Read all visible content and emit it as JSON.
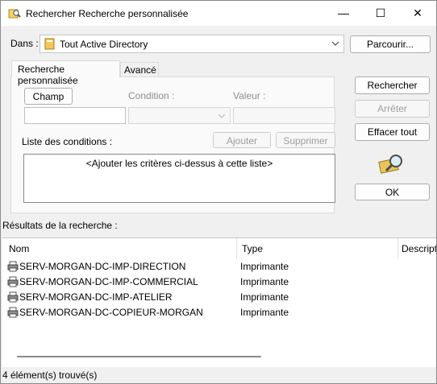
{
  "window": {
    "title": "Rechercher Recherche personnalisée",
    "minimize_glyph": "—",
    "maximize_glyph": "☐",
    "close_glyph": "✕"
  },
  "dans": {
    "label": "Dans :",
    "value": "Tout Active Directory",
    "browse_label": "Parcourir..."
  },
  "tabs": [
    {
      "label": "Recherche personnalisée",
      "active": true
    },
    {
      "label": "Avancé",
      "active": false
    }
  ],
  "criteria": {
    "field_button": "Champ",
    "condition_label": "Condition :",
    "value_label": "Valeur :",
    "add_button": "Ajouter",
    "remove_button": "Supprimer",
    "conditions_label": "Liste des conditions :",
    "conditions_placeholder": "<Ajouter les critères ci-dessus à cette liste>"
  },
  "actions": {
    "search": "Rechercher",
    "stop": "Arrêter",
    "clear_all": "Effacer tout",
    "ok": "OK"
  },
  "results": {
    "label": "Résultats de la recherche :",
    "columns": [
      "Nom",
      "Type",
      "Descript"
    ],
    "rows": [
      {
        "name": "SERV-MORGAN-DC-IMP-DIRECTION",
        "type": "Imprimante"
      },
      {
        "name": "SERV-MORGAN-DC-IMP-COMMERCIAL",
        "type": "Imprimante"
      },
      {
        "name": "SERV-MORGAN-DC-IMP-ATELIER",
        "type": "Imprimante"
      },
      {
        "name": "SERV-MORGAN-DC-COPIEUR-MORGAN",
        "type": "Imprimante"
      }
    ]
  },
  "status": "4 élément(s) trouvé(s)",
  "icons": {
    "title": "search-folder-icon",
    "scope": "directory-book-icon",
    "printer": "printer-icon",
    "magnifier": "magnifier-icon"
  }
}
